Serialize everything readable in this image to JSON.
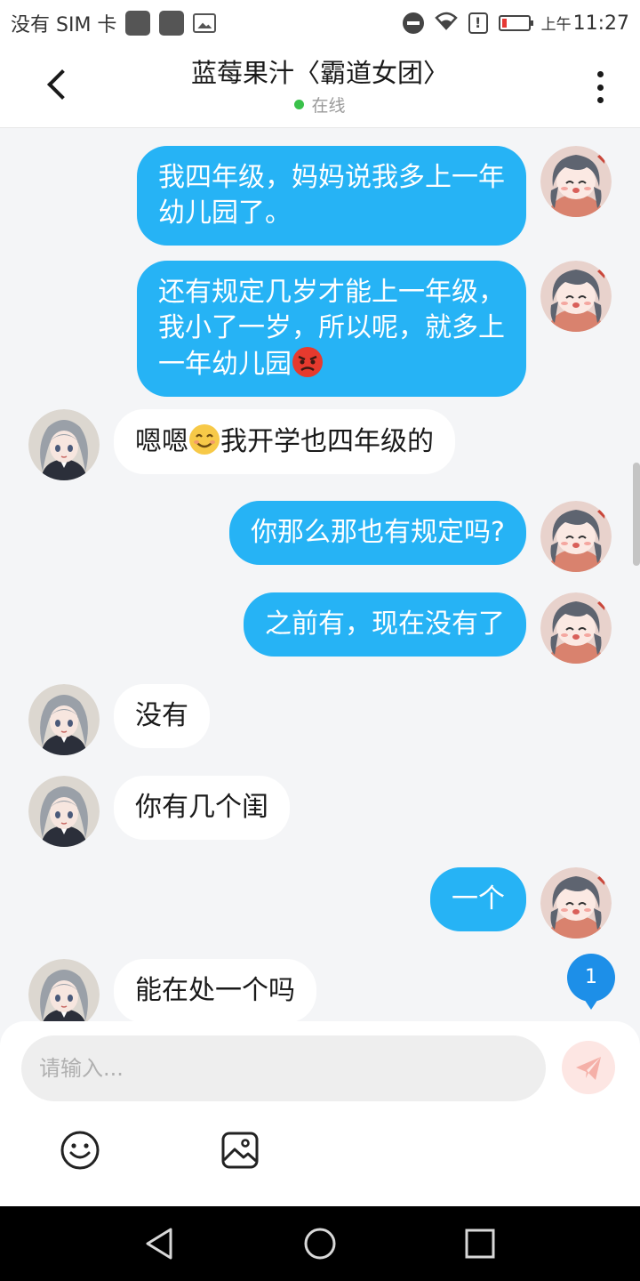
{
  "status_bar": {
    "carrier": "没有 SIM 卡",
    "ampm": "上午",
    "time": "11:27",
    "battery_color": "#e53935"
  },
  "header": {
    "back_icon": "chevron-left-icon",
    "title": "蓝莓果汁〈霸道女团〉",
    "presence": "在线",
    "presence_color": "#3ac14a",
    "more_icon": "more-vertical-icon"
  },
  "messages": [
    {
      "sender": "me",
      "text": "我四年级，妈妈说我多上一年\n幼儿园了。"
    },
    {
      "sender": "me",
      "text": "还有规定几岁才能上一年级，\n我小了一岁，所以呢，就多上\n一年幼儿园",
      "emoji_after": "angry-face"
    },
    {
      "sender": "them",
      "text_before": "嗯嗯",
      "emoji_mid": "smiling-face",
      "text": "我开学也四年级的"
    },
    {
      "sender": "me",
      "text": "你那么那也有规定吗?"
    },
    {
      "sender": "me",
      "text": "之前有，现在没有了"
    },
    {
      "sender": "them",
      "text": "没有"
    },
    {
      "sender": "them",
      "text": "你有几个闺"
    },
    {
      "sender": "me",
      "text": "一个"
    },
    {
      "sender": "them",
      "text": "能在处一个吗"
    }
  ],
  "unread_count": "1",
  "composer": {
    "placeholder": "请输入...",
    "send_icon": "paper-plane-icon",
    "tools": [
      "emoji-icon",
      "image-icon"
    ]
  },
  "colors": {
    "outgoing_bubble": "#26b3f5",
    "incoming_bubble": "#ffffff",
    "background": "#f4f5f7",
    "badge": "#1d8fe8"
  },
  "nav": [
    "back-triangle-icon",
    "home-circle-icon",
    "recents-square-icon"
  ]
}
